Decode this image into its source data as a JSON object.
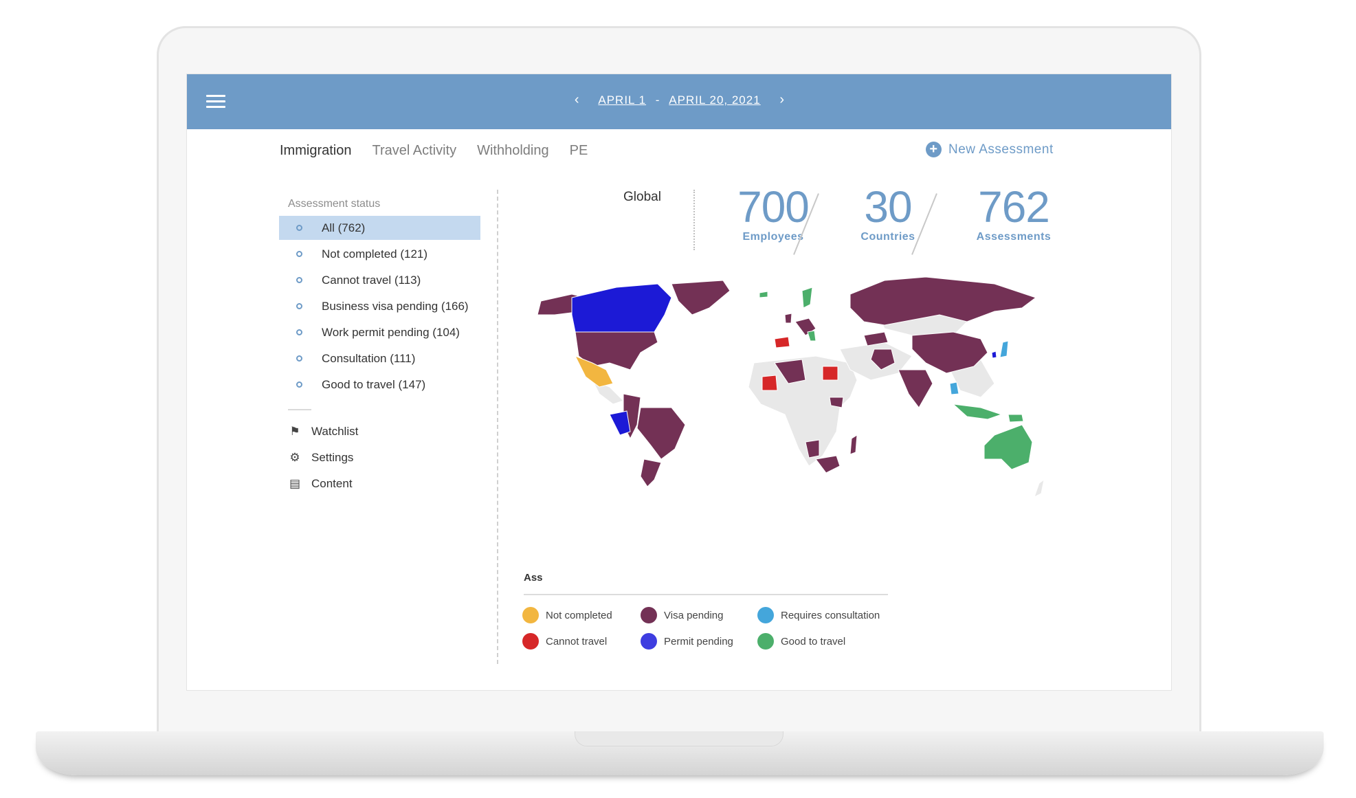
{
  "header": {
    "date_start": "APRIL 1",
    "date_separator": "-",
    "date_end": "APRIL 20, 2021",
    "prev_arrow": "‹",
    "next_arrow": "›"
  },
  "tabs": [
    {
      "label": "Immigration",
      "active": true
    },
    {
      "label": "Travel Activity",
      "active": false
    },
    {
      "label": "Withholding",
      "active": false
    },
    {
      "label": "PE",
      "active": false
    }
  ],
  "new_assessment": {
    "icon": "plus-circle-icon",
    "label": "New Assessment",
    "glyph": "+"
  },
  "sidebar": {
    "title": "Assessment status",
    "statuses": [
      {
        "label": "All",
        "count": "(762)"
      },
      {
        "label": "Not completed",
        "count": "(121)"
      },
      {
        "label": "Cannot travel",
        "count": "(113)"
      },
      {
        "label": "Business visa pending",
        "count": "(166)"
      },
      {
        "label": "Work permit pending",
        "count": "(104)"
      },
      {
        "label": "Consultation",
        "count": "(111)"
      },
      {
        "label": "Good to travel",
        "count": "(147)"
      }
    ],
    "nav": [
      {
        "label": "Watchlist",
        "icon": "flag-icon",
        "glyph": "⚑"
      },
      {
        "label": "Settings",
        "icon": "gear-icon",
        "glyph": "⚙"
      },
      {
        "label": "Content",
        "icon": "document-icon",
        "glyph": "▤"
      }
    ]
  },
  "summary": {
    "scope": "Global",
    "employees": {
      "value": "700",
      "label": "Employees"
    },
    "countries": {
      "value": "30",
      "label": "Countries"
    },
    "assessments": {
      "value": "762",
      "label": "Assessments"
    }
  },
  "legend": {
    "title": "Ass",
    "items": [
      {
        "label": "Not completed",
        "color": "#f2b640"
      },
      {
        "label": "Visa pending",
        "color": "#733155"
      },
      {
        "label": "Requires consultation",
        "color": "#44a6db"
      },
      {
        "label": "Cannot travel",
        "color": "#d62728"
      },
      {
        "label": "Permit pending",
        "color": "#3e3de0"
      },
      {
        "label": "Good to travel",
        "color": "#4caf6b"
      }
    ]
  },
  "colors": {
    "accent": "#6e9bc7",
    "selected_row": "#c4d9ef",
    "neutral_country": "#e8e8e8"
  }
}
